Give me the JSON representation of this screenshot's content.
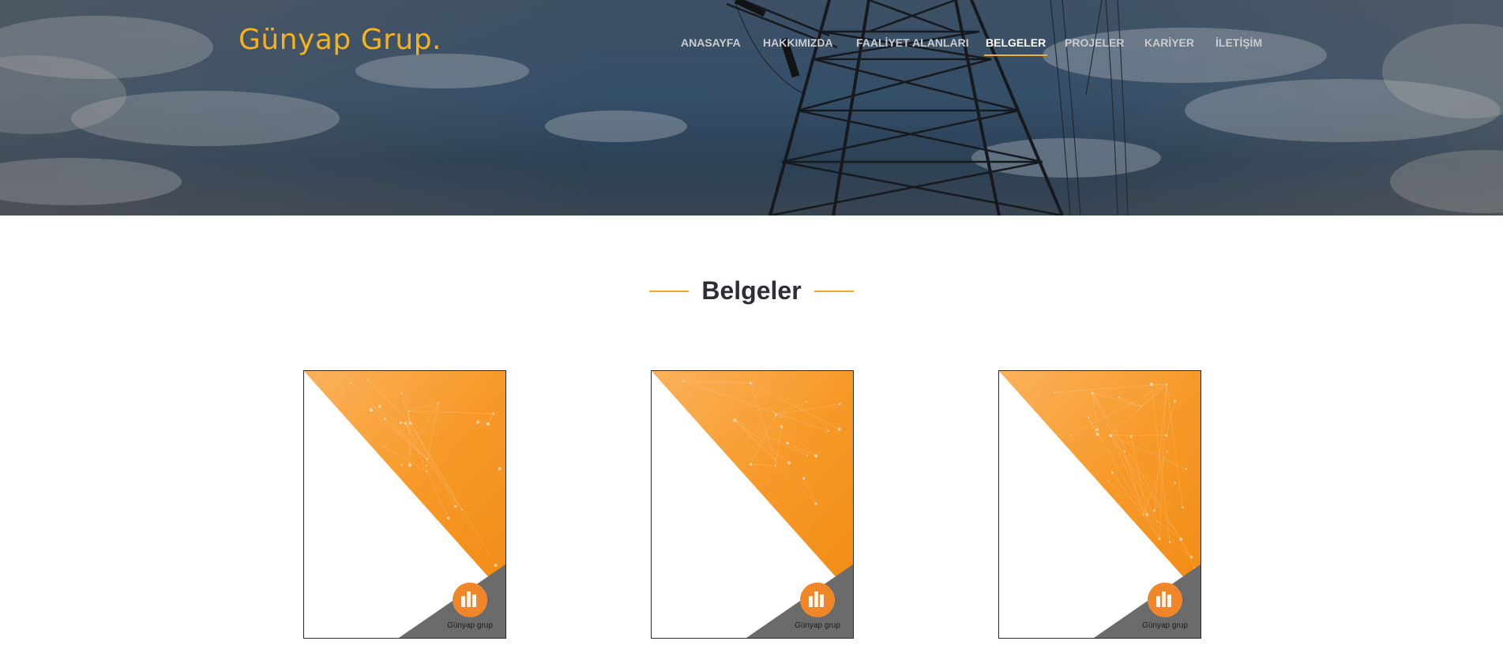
{
  "header": {
    "logo_text": "Günyap Grup.",
    "nav": [
      {
        "label": "ANASAYFA",
        "active": false
      },
      {
        "label": "HAKKIMIZDA",
        "active": false
      },
      {
        "label": "FAALİYET ALANLARI",
        "active": false
      },
      {
        "label": "BELGELER",
        "active": true
      },
      {
        "label": "PROJELER",
        "active": false
      },
      {
        "label": "KARİYER",
        "active": false
      },
      {
        "label": "İLETİŞİM",
        "active": false
      }
    ]
  },
  "main": {
    "section_title": "Belgeler",
    "documents": [
      {
        "logo_text": "Günyap grup"
      },
      {
        "logo_text": "Günyap grup"
      },
      {
        "logo_text": "Günyap grup"
      }
    ]
  },
  "colors": {
    "accent": "#f5b21b",
    "document_orange": "#f7941d",
    "title_text": "#2b2f36"
  }
}
